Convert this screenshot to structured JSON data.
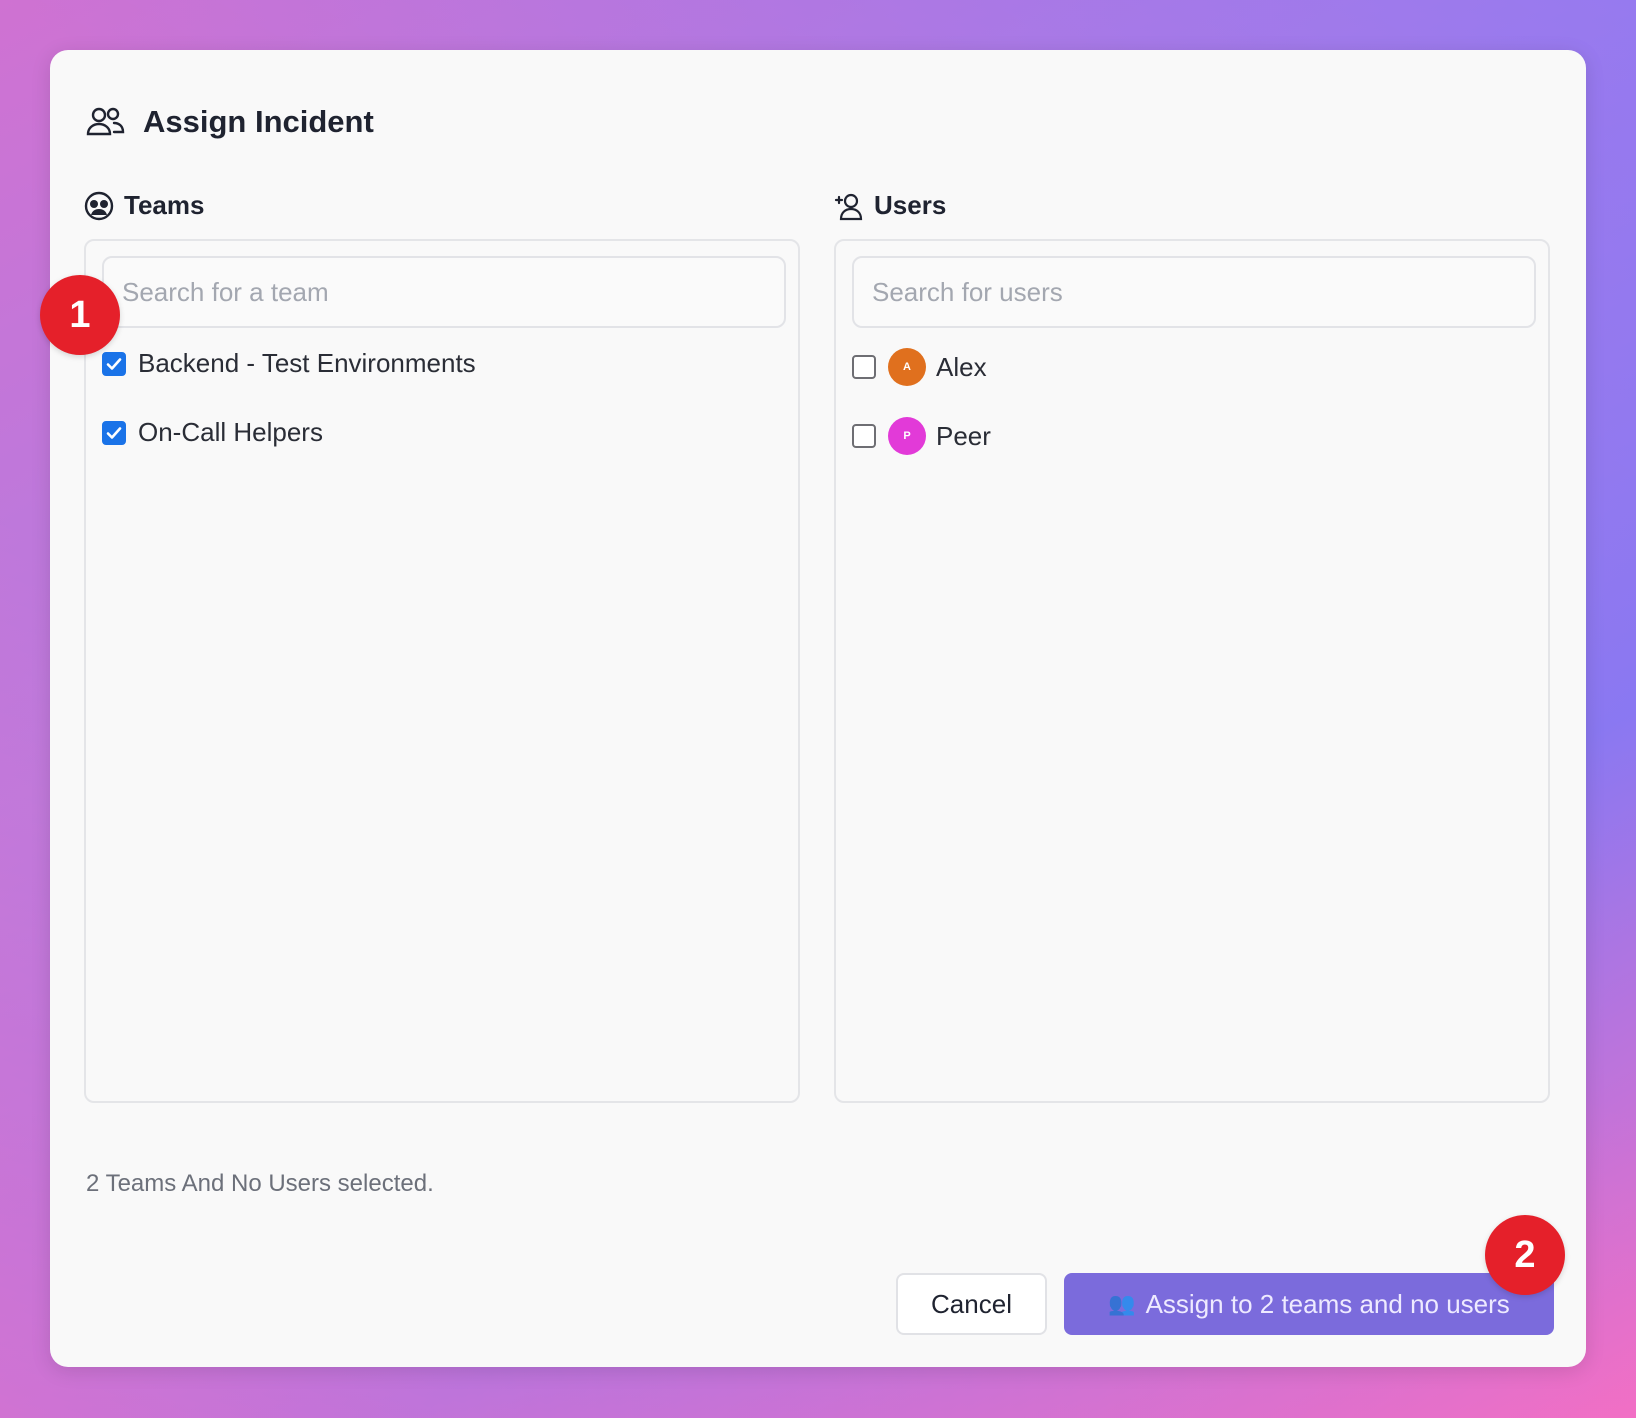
{
  "dialog": {
    "title": "Assign Incident",
    "icon": "users-icon"
  },
  "teams": {
    "label": "Teams",
    "icon": "teams-icon",
    "search_placeholder": "Search for a team",
    "items": [
      {
        "name": "Backend - Test Environments",
        "checked": true
      },
      {
        "name": "On-Call Helpers",
        "checked": true
      }
    ]
  },
  "users": {
    "label": "Users",
    "icon": "user-plus-icon",
    "search_placeholder": "Search for users",
    "items": [
      {
        "name": "Alex",
        "initial": "A",
        "avatar_color": "#e0701e",
        "checked": false
      },
      {
        "name": "Peer",
        "initial": "P",
        "avatar_color": "#e23ad8",
        "checked": false
      }
    ]
  },
  "summary": "2 Teams And No Users selected.",
  "actions": {
    "cancel_label": "Cancel",
    "assign_label": "Assign to 2 teams and no users",
    "assign_icon": "people-icon"
  },
  "annotations": [
    {
      "number": "1"
    },
    {
      "number": "2"
    }
  ],
  "colors": {
    "accent": "#7b6bdc",
    "checkbox": "#1a73e8",
    "badge": "#e5202a"
  }
}
